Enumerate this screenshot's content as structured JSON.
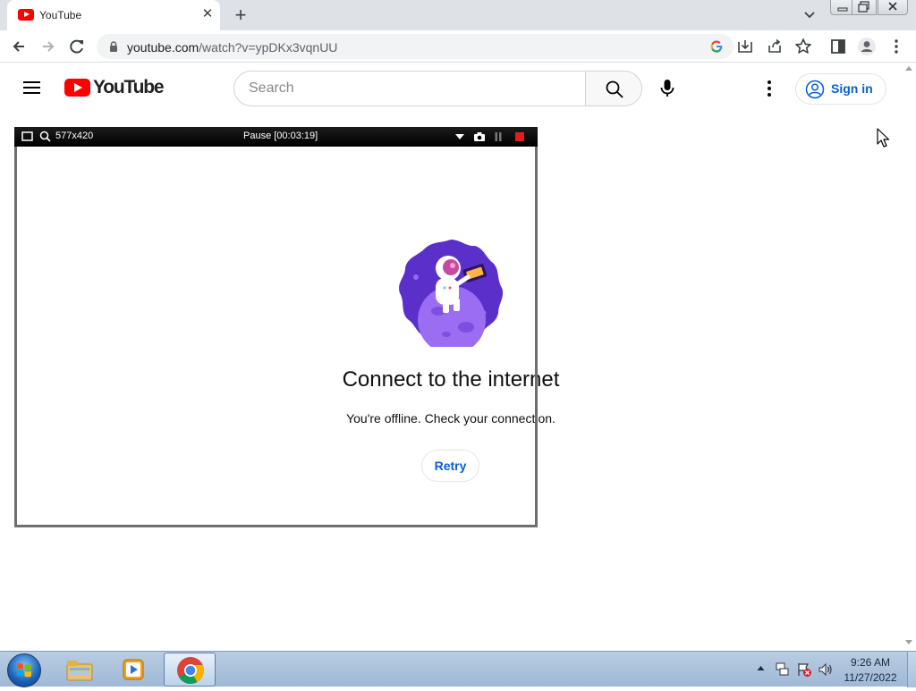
{
  "browser": {
    "tab": {
      "title": "YouTube",
      "close": "✕"
    },
    "new_tab": "+",
    "url": {
      "host": "youtube.com",
      "path": "/watch?v=ypDKx3vqnUU"
    }
  },
  "youtube": {
    "logo_text": "YouTube",
    "search_placeholder": "Search",
    "sign_in": "Sign in",
    "brand_color": "#ff0000",
    "link_color": "#065fd4"
  },
  "recorder": {
    "size": "577x420",
    "status": "Pause [00:03:19]"
  },
  "offline": {
    "title": "Connect to the internet",
    "message": "You're offline. Check your connection.",
    "retry": "Retry"
  },
  "taskbar": {
    "time": "9:26 AM",
    "date": "11/27/2022"
  },
  "icons": {
    "browser": [
      "youtube-favicon",
      "tab-close-icon",
      "new-tab-icon",
      "tab-search-icon",
      "back-icon",
      "forward-icon",
      "reload-icon",
      "lock-icon",
      "google-icon",
      "install-icon",
      "share-icon",
      "bookmark-star-icon",
      "side-panel-icon",
      "profile-icon",
      "chrome-menu-icon"
    ],
    "youtube": [
      "hamburger-menu-icon",
      "search-icon",
      "microphone-icon",
      "more-vert-icon",
      "account-icon"
    ],
    "recorder": [
      "window-icon",
      "zoom-icon",
      "dropdown-icon",
      "camera-icon",
      "pause-icon",
      "stop-icon"
    ],
    "taskbar": [
      "start-orb-icon",
      "file-explorer-icon",
      "media-player-icon",
      "chrome-icon",
      "tray-expand-icon",
      "network-icon",
      "action-center-icon",
      "volume-icon"
    ]
  }
}
